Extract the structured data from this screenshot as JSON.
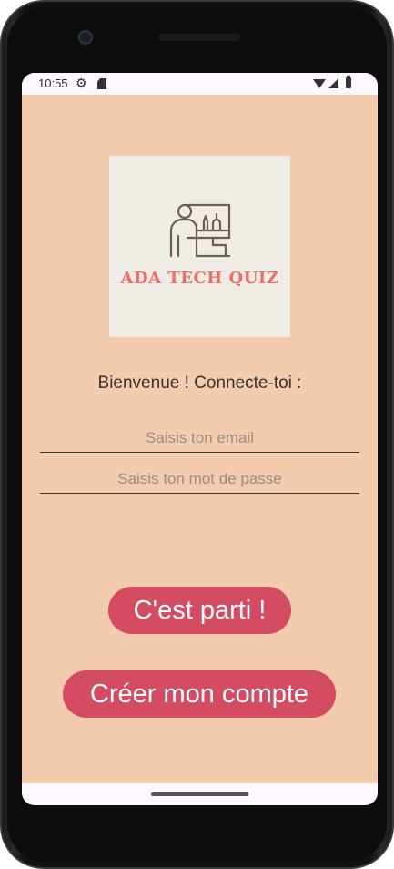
{
  "status_bar": {
    "time": "10:55",
    "icons": [
      "settings-gear-icon",
      "sd-card-icon",
      "wifi-icon",
      "cell-signal-icon",
      "battery-icon"
    ]
  },
  "logo": {
    "text": "ADA TECH QUIZ",
    "icon": "person-at-desk-icon",
    "background_color": "#efebe5",
    "text_color": "#ef6f67"
  },
  "login": {
    "welcome": "Bienvenue ! Connecte-toi :",
    "email_placeholder": "Saisis ton email",
    "email_value": "",
    "password_placeholder": "Saisis ton mot de passe",
    "password_value": ""
  },
  "buttons": {
    "go_label": "C'est parti !",
    "create_label": "Créer mon compte"
  },
  "colors": {
    "app_background": "#f3cbad",
    "button": "#d44c61",
    "button_text": "#ffffff"
  }
}
